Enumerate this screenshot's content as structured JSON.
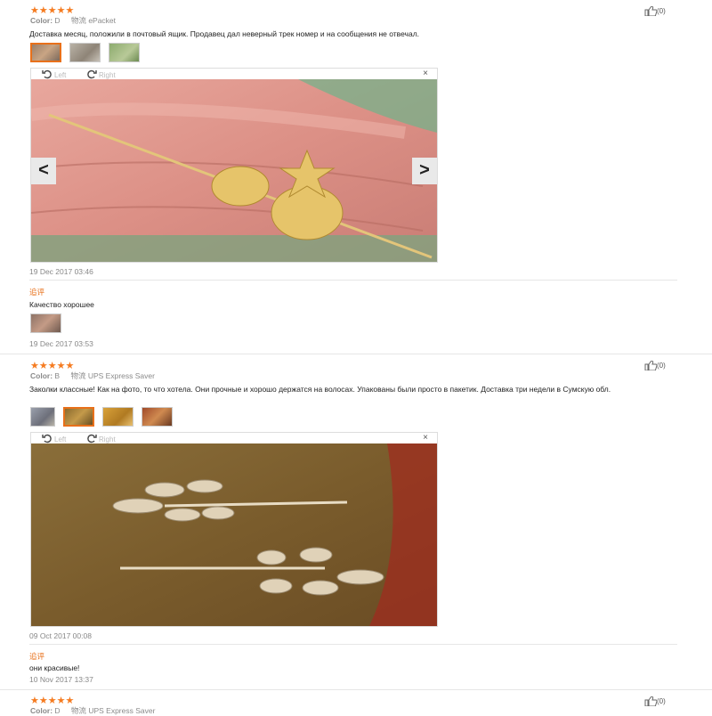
{
  "reviews": [
    {
      "stars": "★★★★★",
      "color_label": "Color:",
      "color_value": "D",
      "shipping_label": "物流",
      "shipping_value": "ePacket",
      "likes": "(0)",
      "text": "Доставка месяц, положили в почтовый ящик. Продавец дал неверный трек номер и на сообщения не отвечал.",
      "viewer": {
        "left": "Left",
        "right": "Right",
        "close": "×"
      },
      "date": "19 Dec 2017 03:46",
      "additional": {
        "label": "追评",
        "text": "Качество хорошее",
        "date": "19 Dec 2017 03:53"
      }
    },
    {
      "stars": "★★★★★",
      "color_label": "Color:",
      "color_value": "B",
      "shipping_label": "物流",
      "shipping_value": "UPS Express Saver",
      "likes": "(0)",
      "text": "Заколки классные! Как на фото, то что хотела. Они прочные и хорошо держатся на волосах. Упакованы были просто в пакетик. Доставка три недели в Сумскую обл.",
      "viewer": {
        "left": "Left",
        "right": "Right",
        "close": "×"
      },
      "date": "09 Oct 2017 00:08",
      "additional": {
        "label": "追评",
        "text": "они красивые!",
        "date": "10 Nov 2017 13:37"
      }
    },
    {
      "stars": "★★★★★",
      "color_label": "Color:",
      "color_value": "D",
      "shipping_label": "物流",
      "shipping_value": "UPS Express Saver",
      "likes": "(0)"
    }
  ],
  "colors": {
    "accent": "#f57b20",
    "addl": "#e8701a"
  }
}
